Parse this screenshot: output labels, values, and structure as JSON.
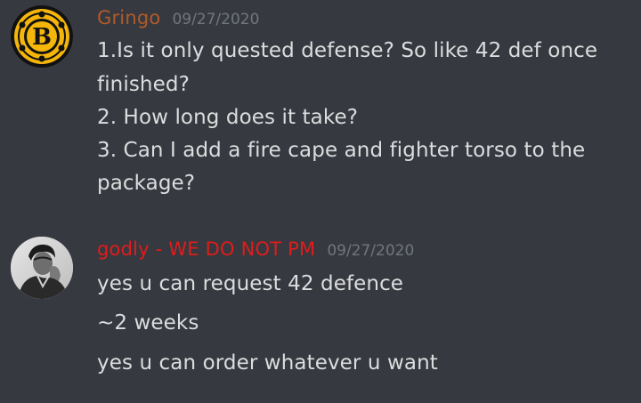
{
  "messages": [
    {
      "author": "Gringo",
      "author_color": "#b05b2a",
      "timestamp": "09/27/2020",
      "avatar_icon": "boston-bruins-logo",
      "lines": [
        "1.Is it only quested defense? So like 42 def once",
        "finished?",
        "2. How long does it take?",
        "3. Can I add a fire cape and fighter torso to the",
        "package?"
      ]
    },
    {
      "author": "godly - WE DO NOT PM",
      "author_color": "#e01c1c",
      "timestamp": "09/27/2020",
      "avatar_icon": "user-photo-avatar",
      "lines": [
        "yes u can request 42 defence",
        "~2 weeks",
        "yes u can order whatever u want"
      ]
    }
  ]
}
